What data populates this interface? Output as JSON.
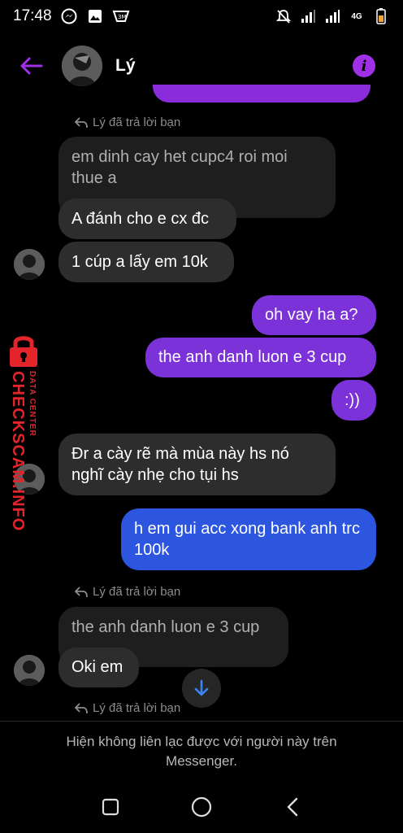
{
  "status_bar": {
    "time": "17:48",
    "left_icons": [
      "messenger-icon",
      "gallery-icon",
      "app-icon"
    ],
    "right_icons": [
      "mute-icon",
      "signal-icon",
      "signal-icon",
      "4g-icon",
      "battery-icon"
    ],
    "network_label": "4G"
  },
  "header": {
    "contact_name": "Lý"
  },
  "messages": [
    {
      "type": "reply_note",
      "text": "Lý đã trả lời bạn"
    },
    {
      "type": "quoted_incoming",
      "text": "em dinh cay het cupc4 roi moi thue a"
    },
    {
      "type": "incoming",
      "text": "A đánh cho e cx đc"
    },
    {
      "type": "incoming",
      "text": "1 cúp a lấy em 10k"
    },
    {
      "type": "outgoing",
      "text": "oh vay ha a?"
    },
    {
      "type": "outgoing",
      "text": "the anh danh luon e 3 cup"
    },
    {
      "type": "outgoing",
      "text": ":))"
    },
    {
      "type": "incoming",
      "text": "Đr a cày rẽ mà mùa này hs nó nghĩ cày nhẹ cho tụi hs"
    },
    {
      "type": "outgoing",
      "text": "h em gui acc xong bank anh trc 100k"
    },
    {
      "type": "reply_note",
      "text": "Lý đã trả lời bạn"
    },
    {
      "type": "quoted_incoming",
      "text": "the anh danh luon e 3 cup"
    },
    {
      "type": "incoming",
      "text": "Oki em"
    },
    {
      "type": "reply_note",
      "text": "Lý đã trả lời bạn"
    }
  ],
  "watermark": {
    "main": "CHECKSCAM.INFO",
    "sub": "DATA CENTER"
  },
  "footer": {
    "line1": "Hiện không liên lạc được với người này trên",
    "line2": "Messenger."
  },
  "colors": {
    "accent_purple": "#a030e6",
    "outgoing_purple": "#7b32d8",
    "outgoing_blue": "#2c55e0",
    "incoming": "#2d2d2d",
    "watermark_red": "#e3242b"
  }
}
